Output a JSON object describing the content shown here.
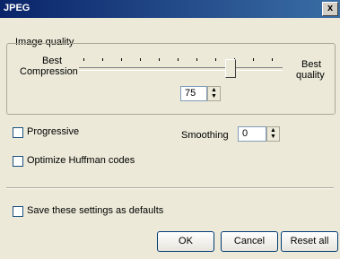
{
  "window": {
    "title": "JPEG",
    "close_glyph": "x"
  },
  "image_quality": {
    "group_label": "Image quality",
    "left_label": [
      "Best",
      "Compression"
    ],
    "right_label": [
      "Best",
      "quality"
    ],
    "quality_value": "75",
    "slider_level_percent": 75
  },
  "options": {
    "progressive_label": "Progressive",
    "progressive_checked": false,
    "huffman_label": "Optimize Huffman codes",
    "huffman_checked": false,
    "smoothing_label": "Smoothing",
    "smoothing_value": "0"
  },
  "defaults": {
    "save_label": "Save these settings as defaults",
    "save_checked": false
  },
  "buttons": {
    "ok": "OK",
    "cancel": "Cancel",
    "reset": "Reset all"
  },
  "icons": {
    "spin_up": "spin-up-icon",
    "spin_down": "spin-down-icon",
    "close": "close-icon"
  }
}
